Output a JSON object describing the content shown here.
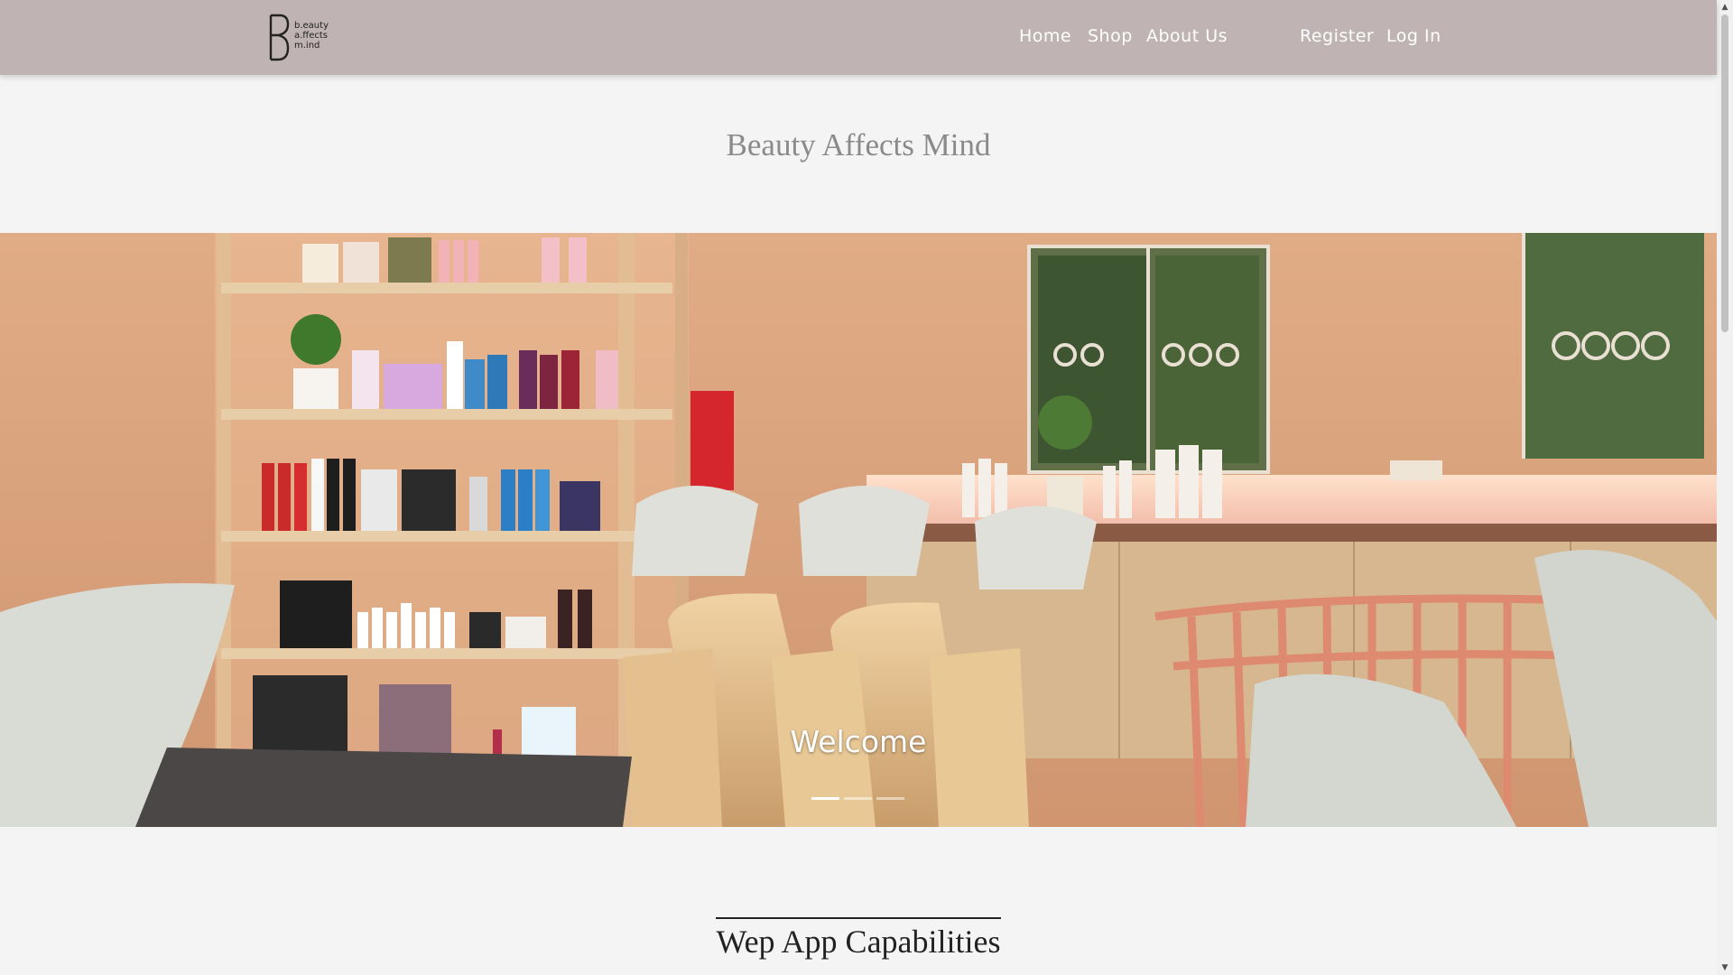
{
  "navbar": {
    "logo": {
      "lines": [
        "b.eauty",
        "a.ffects",
        "m.ind"
      ]
    },
    "links": {
      "home": "Home",
      "shop": "Shop",
      "about": "About Us",
      "register": "Register",
      "login": "Log In"
    },
    "colors": {
      "background": "#bfb3b3",
      "link": "#ffffff"
    }
  },
  "header": {
    "title": "Beauty Affects Mind"
  },
  "carousel": {
    "caption": "Welcome",
    "slide_count": 3,
    "active_slide": 1,
    "image_subject": "salon-interior-photo"
  },
  "capabilities": {
    "title": "Wep App Capabilities"
  },
  "scrollbar": {
    "up_icon": "arrow-up-icon",
    "down_icon": "arrow-down-icon"
  }
}
